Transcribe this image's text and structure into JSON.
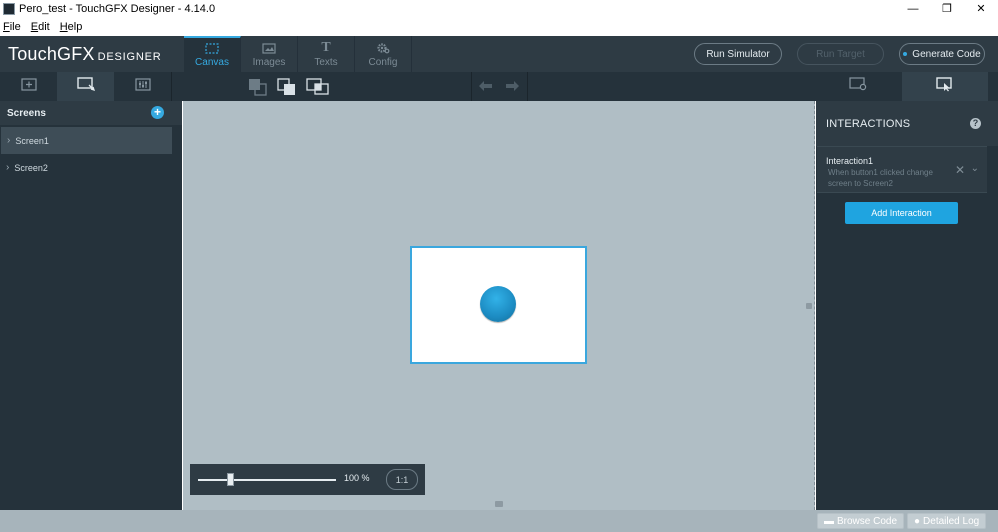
{
  "window": {
    "title": "Pero_test - TouchGFX Designer - 4.14.0",
    "controls": [
      "—",
      "❐",
      "✕"
    ]
  },
  "menu": {
    "items": [
      {
        "label": "File",
        "underline": "F",
        "rest": "ile"
      },
      {
        "label": "Edit",
        "underline": "E",
        "rest": "dit"
      },
      {
        "label": "Help",
        "underline": "H",
        "rest": "elp"
      }
    ]
  },
  "header": {
    "logo_main": "TouchGFX",
    "logo_sub": "DESIGNER",
    "tabs": [
      {
        "label": "Canvas",
        "icon": "canvas-icon",
        "active": true
      },
      {
        "label": "Images",
        "icon": "image-icon",
        "active": false
      },
      {
        "label": "Texts",
        "icon": "text-icon",
        "active": false
      },
      {
        "label": "Config",
        "icon": "gear-icon",
        "active": false
      }
    ],
    "run_simulator": "Run Simulator",
    "run_target": "Run Target",
    "generate_code": "Generate Code"
  },
  "left_panel": {
    "title": "Screens",
    "screens": [
      {
        "label": "Screen1",
        "selected": true
      },
      {
        "label": "Screen2",
        "selected": false
      }
    ]
  },
  "canvas": {
    "zoom_label": "100 %",
    "zoom_level": 0.23,
    "one_to_one": "1:1"
  },
  "right_panel": {
    "title": "INTERACTIONS",
    "interaction": {
      "name": "Interaction1",
      "description": "When button1 clicked change screen to Screen2"
    },
    "add_button": "Add Interaction"
  },
  "status": {
    "browse_code": "Browse Code",
    "detailed_log": "Detailed Log"
  },
  "colors": {
    "accent": "#35a9e0",
    "header_bg": "#2e3b44",
    "panel_bg": "#25323b",
    "canvas_bg": "#b0bec5"
  }
}
